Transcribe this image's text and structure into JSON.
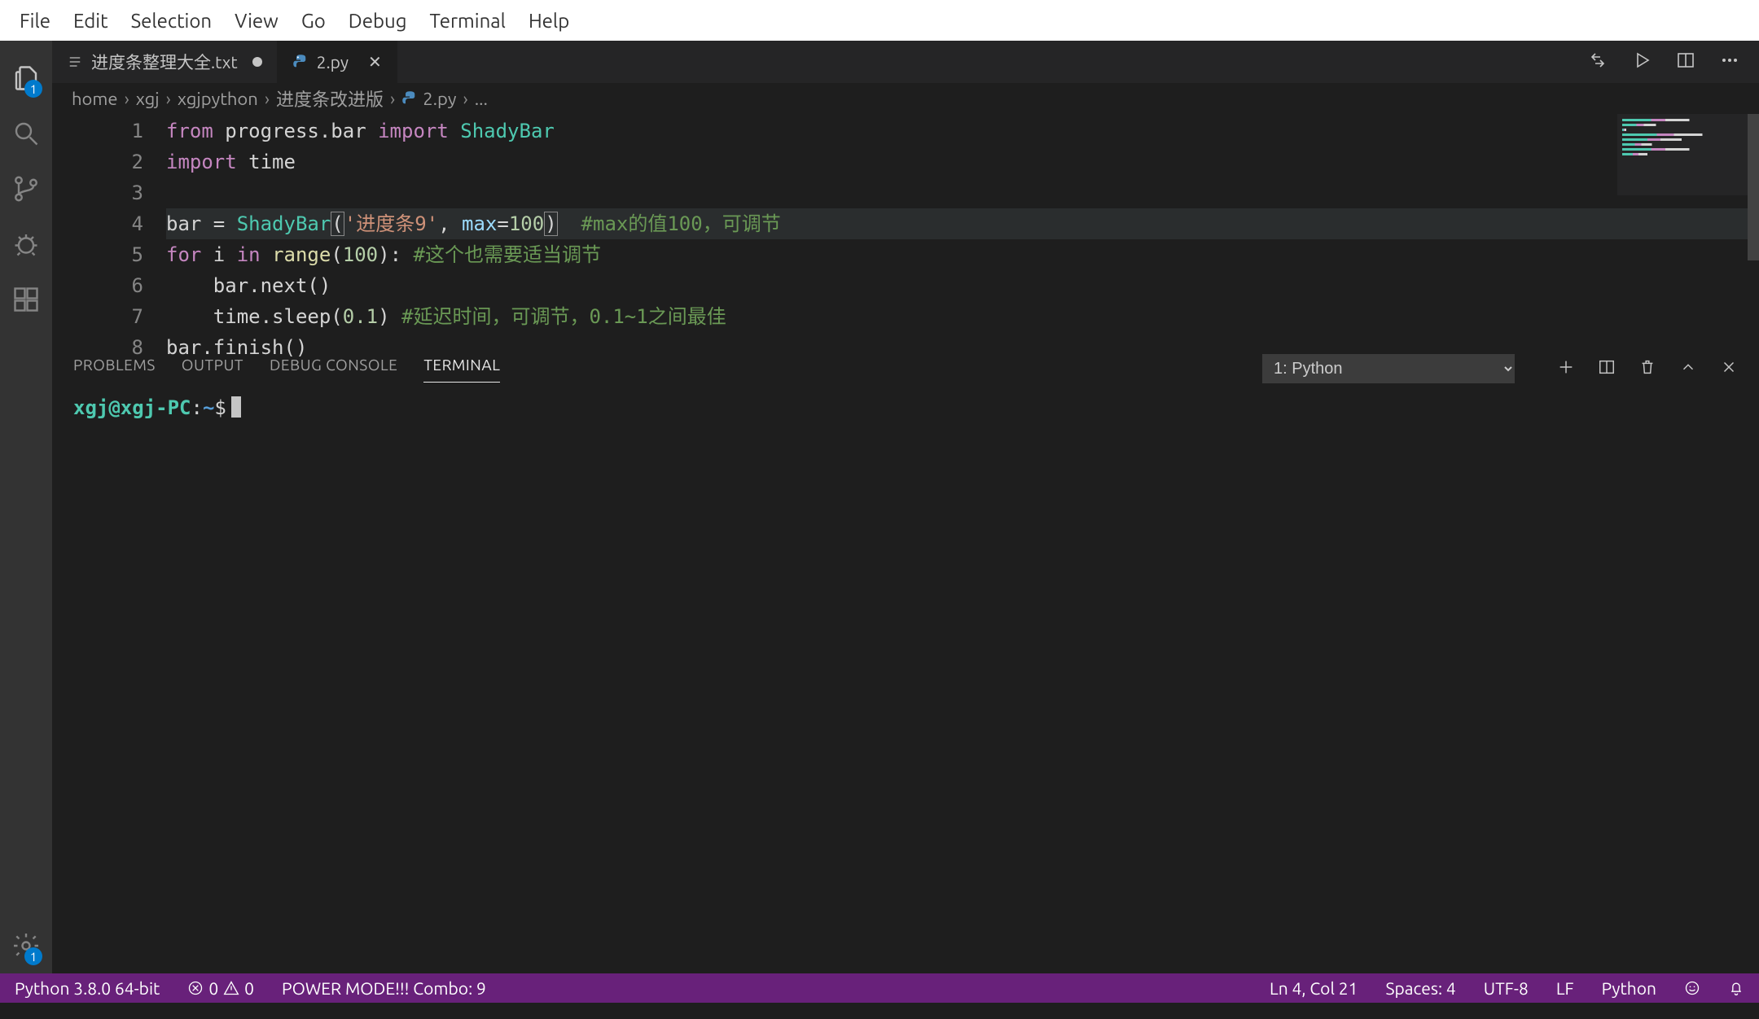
{
  "menu": {
    "items": [
      "File",
      "Edit",
      "Selection",
      "View",
      "Go",
      "Debug",
      "Terminal",
      "Help"
    ]
  },
  "activity": {
    "explorer_badge": "1",
    "settings_badge": "1"
  },
  "tabs": {
    "items": [
      {
        "label": "进度条整理大全.txt",
        "dirty": true,
        "active": false,
        "icon": "text"
      },
      {
        "label": "2.py",
        "dirty": false,
        "active": true,
        "icon": "python"
      }
    ]
  },
  "breadcrumbs": {
    "parts": [
      "home",
      "xgj",
      "xgjpython",
      "进度条改进版",
      "2.py",
      "..."
    ]
  },
  "code": {
    "lines": [
      {
        "n": "1",
        "tokens": [
          [
            "kw",
            "from"
          ],
          [
            "pl",
            " progress.bar "
          ],
          [
            "kw",
            "import"
          ],
          [
            "pl",
            " "
          ],
          [
            "cls",
            "ShadyBar"
          ]
        ]
      },
      {
        "n": "2",
        "tokens": [
          [
            "kw",
            "import"
          ],
          [
            "pl",
            " time"
          ]
        ]
      },
      {
        "n": "3",
        "tokens": []
      },
      {
        "n": "4",
        "hl": true,
        "tokens": [
          [
            "pl",
            "bar = "
          ],
          [
            "cls",
            "ShadyBar"
          ],
          [
            "bm",
            "("
          ],
          [
            "str",
            "'进度条9'"
          ],
          [
            "pl",
            ", "
          ],
          [
            "var",
            "max"
          ],
          [
            "pl",
            "="
          ],
          [
            "num",
            "100"
          ],
          [
            "bm",
            ")"
          ],
          [
            "pl",
            "  "
          ],
          [
            "cmt",
            "#max的值100，可调节"
          ]
        ]
      },
      {
        "n": "5",
        "tokens": [
          [
            "kw",
            "for"
          ],
          [
            "pl",
            " i "
          ],
          [
            "kw",
            "in"
          ],
          [
            "pl",
            " "
          ],
          [
            "fn",
            "range"
          ],
          [
            "pl",
            "("
          ],
          [
            "num",
            "100"
          ],
          [
            "pl",
            "): "
          ],
          [
            "cmt",
            "#这个也需要适当调节"
          ]
        ]
      },
      {
        "n": "6",
        "tokens": [
          [
            "pl",
            "    bar.next()"
          ]
        ]
      },
      {
        "n": "7",
        "tokens": [
          [
            "pl",
            "    time.sleep("
          ],
          [
            "num",
            "0.1"
          ],
          [
            "pl",
            ") "
          ],
          [
            "cmt",
            "#延迟时间，可调节，0.1~1之间最佳"
          ]
        ]
      },
      {
        "n": "8",
        "tokens": [
          [
            "pl",
            "bar.finish()"
          ]
        ]
      }
    ]
  },
  "panel": {
    "tabs": [
      "PROBLEMS",
      "OUTPUT",
      "DEBUG CONSOLE",
      "TERMINAL"
    ],
    "active_tab": "TERMINAL",
    "terminal_selector": "1: Python",
    "prompt_user": "xgj@xgj-PC",
    "prompt_path": "~",
    "prompt_symbol": "$"
  },
  "status": {
    "python": "Python 3.8.0 64-bit",
    "errors": "0",
    "warnings": "0",
    "powermode": "POWER MODE!!! Combo: 9",
    "ln_col": "Ln 4, Col 21",
    "spaces": "Spaces: 4",
    "encoding": "UTF-8",
    "eol": "LF",
    "lang": "Python"
  }
}
